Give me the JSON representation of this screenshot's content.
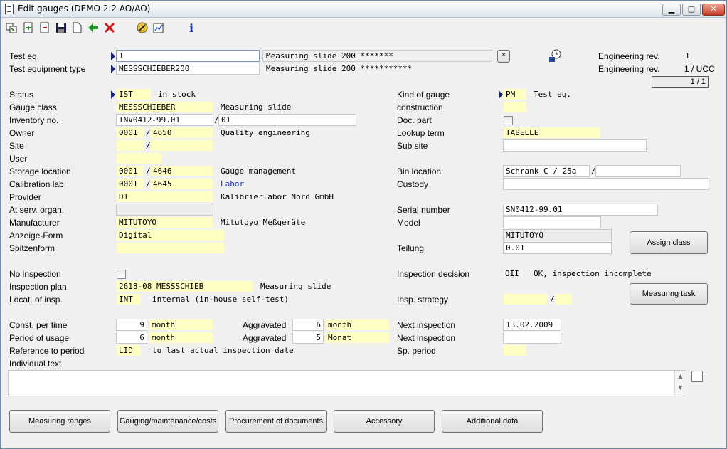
{
  "window": {
    "title": "Edit gauges (DEMO 2.2 AO/AO)",
    "minimize": "▁",
    "maximize": "□",
    "close": "✕"
  },
  "toolbar": {
    "info": "i"
  },
  "header": {
    "test_eq_label": "Test eq.",
    "test_eq_value": "1",
    "test_eq_desc": "Measuring slide 200 *******",
    "test_eq_btn": "*",
    "type_label": "Test equipment type",
    "type_value": "MESSSCHIEBER200",
    "type_desc": "Measuring slide 200 ***********",
    "eng_rev_label_1": "Engineering rev.",
    "eng_rev_value_1": "1",
    "eng_rev_label_2": "Engineering rev.",
    "eng_rev_value_2": "1 / UCC",
    "page_counter": "1 / 1"
  },
  "left": {
    "status": {
      "label": "Status",
      "code": "IST",
      "desc": "in stock"
    },
    "gauge_class": {
      "label": "Gauge class",
      "code": "MESSSCHIEBER",
      "desc": "Measuring slide"
    },
    "inventory": {
      "label": "Inventory no.",
      "value": "INV0412-99.01",
      "sep": "/",
      "suffix": "01"
    },
    "owner": {
      "label": "Owner",
      "code1": "0001",
      "sep": "/",
      "code2": "4650",
      "desc": "Quality engineering"
    },
    "site": {
      "label": "Site",
      "sep": "/"
    },
    "user": {
      "label": "User"
    },
    "storage": {
      "label": "Storage location",
      "code1": "0001",
      "sep": "/",
      "code2": "4646",
      "desc": "Gauge management"
    },
    "calib_lab": {
      "label": "Calibration lab",
      "code1": "0001",
      "sep": "/",
      "code2": "4645",
      "desc": "Labor"
    },
    "provider": {
      "label": "Provider",
      "code": "D1",
      "desc": "Kalibrierlabor Nord GmbH"
    },
    "at_serv": {
      "label": "At serv. organ."
    },
    "manufacturer": {
      "label": "Manufacturer",
      "code": "MITUTOYO",
      "desc": "Mitutoyo Meßgeräte"
    },
    "anzeige": {
      "label": "Anzeige-Form",
      "value": "Digital"
    },
    "spitzen": {
      "label": "Spitzenform"
    },
    "no_insp": {
      "label": "No inspection"
    },
    "insp_plan": {
      "label": "Inspection plan",
      "code": "2618-08 MESSSCHIEB",
      "desc": "Measuring slide"
    },
    "locat_insp": {
      "label": "Locat. of insp.",
      "code": "INT",
      "desc": "internal (in-house self-test)"
    },
    "const_per_time": {
      "label": "Const. per time",
      "num": "9",
      "unit": "month",
      "agg_label": "Aggravated",
      "agg_num": "6",
      "agg_unit": "month"
    },
    "period_usage": {
      "label": "Period of usage",
      "num": "6",
      "unit": "month",
      "agg_label": "Aggravated",
      "agg_num": "5",
      "agg_unit": "Monat"
    },
    "ref_period": {
      "label": "Reference to period",
      "code": "LID",
      "desc": "to last actual inspection date"
    },
    "indiv_text": {
      "label": "Individual text"
    }
  },
  "right": {
    "kind": {
      "label": "Kind of gauge",
      "code": "PM",
      "desc": "Test eq."
    },
    "construction": {
      "label": "construction"
    },
    "doc_part": {
      "label": "Doc. part"
    },
    "lookup": {
      "label": "Lookup term",
      "value": "TABELLE"
    },
    "sub_site": {
      "label": "Sub site"
    },
    "bin": {
      "label": "Bin location",
      "value": "Schrank C / 25a",
      "sep": "/"
    },
    "custody": {
      "label": "Custody"
    },
    "serial": {
      "label": "Serial number",
      "value": "SN0412-99.01"
    },
    "model": {
      "label": "Model"
    },
    "model_line2": {
      "value": "MITUTOYO"
    },
    "teilung": {
      "label": "Teilung",
      "value": "0.01"
    },
    "insp_decision": {
      "label": "Inspection decision",
      "code": "OII",
      "desc": "OK, inspection incomplete"
    },
    "insp_strategy": {
      "label": "Insp. strategy",
      "sep": "/"
    },
    "next_insp_1": {
      "label": "Next inspection",
      "value": "13.02.2009"
    },
    "next_insp_2": {
      "label": "Next inspection"
    },
    "sp_period": {
      "label": "Sp. period"
    },
    "assign_class": "Assign class",
    "measuring_task": "Measuring task"
  },
  "bottom_buttons": [
    "Measuring ranges",
    "Gauging/maintenance/costs",
    "Procurement of documents",
    "Accessory",
    "Additional data"
  ]
}
